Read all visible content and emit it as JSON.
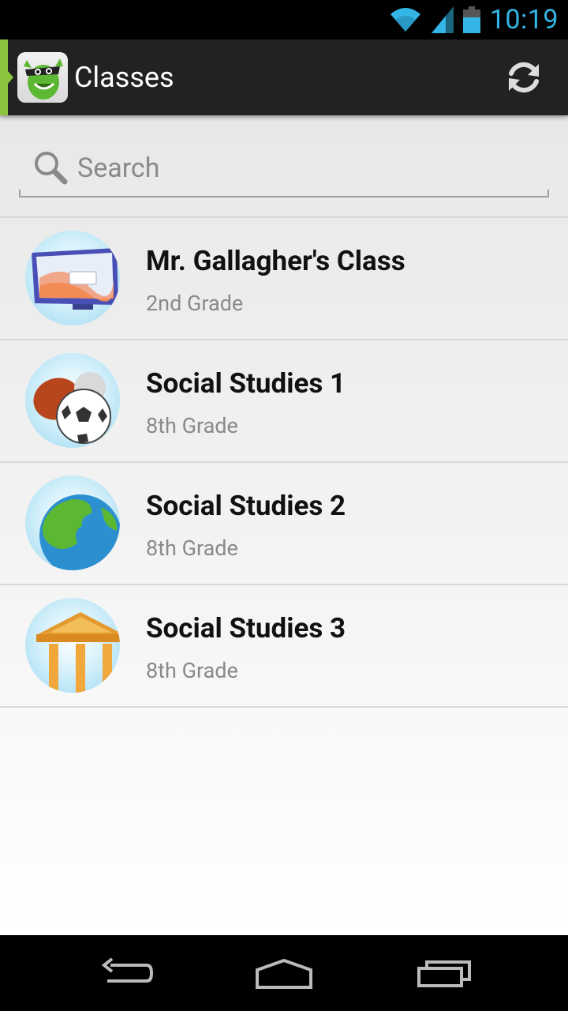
{
  "status_bar": {
    "time": "10:19",
    "icons": [
      "wifi-icon",
      "cell-signal-icon",
      "battery-icon"
    ]
  },
  "action_bar": {
    "title": "Classes",
    "app_icon": "classdojo-monster-icon",
    "refresh_icon": "refresh-icon"
  },
  "search": {
    "placeholder": "Search",
    "value": ""
  },
  "classes": [
    {
      "name": "Mr. Gallagher's Class",
      "grade": "2nd Grade",
      "icon": "computer-monitor-icon"
    },
    {
      "name": "Social Studies 1",
      "grade": "8th Grade",
      "icon": "sports-balls-icon"
    },
    {
      "name": "Social Studies 2",
      "grade": "8th Grade",
      "icon": "globe-icon"
    },
    {
      "name": "Social Studies 3",
      "grade": "8th Grade",
      "icon": "courthouse-icon"
    }
  ],
  "nav_bar": {
    "buttons": [
      "back-icon",
      "home-icon",
      "recent-apps-icon"
    ]
  },
  "colors": {
    "accent": "#8bc53f",
    "status_time": "#33b5e5",
    "action_bar": "#222222"
  }
}
